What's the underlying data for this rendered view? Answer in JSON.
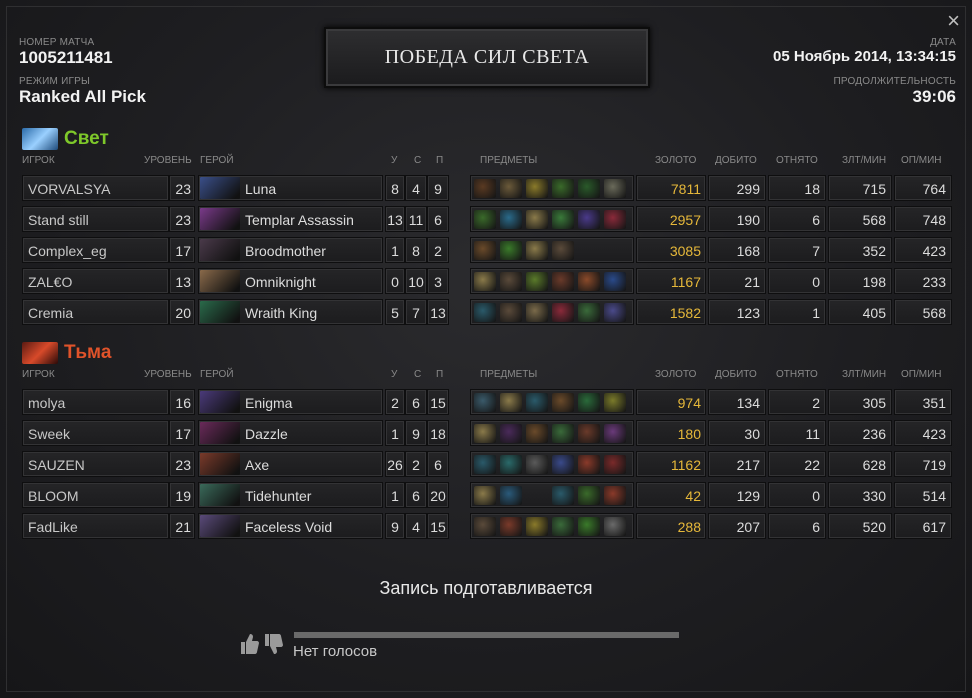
{
  "match": {
    "id_label": "НОМЕР МАТЧА",
    "id": "1005211481",
    "mode_label": "РЕЖИМ ИГРЫ",
    "mode": "Ranked All Pick",
    "date_label": "ДАТА",
    "date": "05 Ноябрь 2014, 13:34:15",
    "duration_label": "ПРОДОЛЖИТЕЛЬНОСТЬ",
    "duration": "39:06",
    "result": "ПОБЕДА СИЛ СВЕТА",
    "close_icon": "×"
  },
  "columns": {
    "player": "ИГРОК",
    "level": "УРОВЕНЬ",
    "hero": "ГЕРОЙ",
    "kills": "У",
    "deaths": "С",
    "assists": "П",
    "items": "ПРЕДМЕТЫ",
    "gold": "ЗОЛОТО",
    "last_hits": "ДОБИТО",
    "denies": "ОТНЯТО",
    "gpm": "ЗЛТ/МИН",
    "xpm": "ОП/МИН"
  },
  "colors": {
    "radiant": "#7ec82a",
    "dire": "#e0532a",
    "gold": "#e6b83a"
  },
  "radiant": {
    "name": "Свет",
    "players": [
      {
        "player": "VORVALSYA",
        "level": "23",
        "hero": "Luna",
        "k": "8",
        "d": "4",
        "a": "9",
        "gold": "7811",
        "lh": "299",
        "dn": "18",
        "gpm": "715",
        "xpm": "764",
        "portrait": "#3a4f8a",
        "items": [
          "#5a3a22",
          "#6b5a3a",
          "#8a7a2a",
          "#3a6a2a",
          "#2a5a2a",
          "#6a6a5a"
        ]
      },
      {
        "player": "Stand still",
        "level": "23",
        "hero": "Templar Assassin",
        "k": "13",
        "d": "11",
        "a": "6",
        "gold": "2957",
        "lh": "190",
        "dn": "6",
        "gpm": "568",
        "xpm": "748",
        "portrait": "#7a3a8a",
        "items": [
          "#3a6a2a",
          "#2a6a8a",
          "#8a7a4a",
          "#3a7a3a",
          "#4a3a8a",
          "#8a2a3a"
        ]
      },
      {
        "player": "Complex_eg",
        "level": "17",
        "hero": "Broodmother",
        "k": "1",
        "d": "8",
        "a": "2",
        "gold": "3085",
        "lh": "168",
        "dn": "7",
        "gpm": "352",
        "xpm": "423",
        "portrait": "#4a3a4a",
        "items": [
          "#6a4a2a",
          "#3a7a2a",
          "#8a7a4a",
          "#5a4a3a"
        ]
      },
      {
        "player": "ZAL€O",
        "level": "13",
        "hero": "Omniknight",
        "k": "0",
        "d": "10",
        "a": "3",
        "gold": "1167",
        "lh": "21",
        "dn": "0",
        "gpm": "198",
        "xpm": "233",
        "portrait": "#8a6a4a",
        "items": [
          "#8a7a4a",
          "#5a4a3a",
          "#5a7a2a",
          "#6a3a2a",
          "#8a4a2a",
          "#2a4a8a"
        ]
      },
      {
        "player": "Cremia",
        "level": "20",
        "hero": "Wraith King",
        "k": "5",
        "d": "7",
        "a": "13",
        "gold": "1582",
        "lh": "123",
        "dn": "1",
        "gpm": "405",
        "xpm": "568",
        "portrait": "#2a6a4a",
        "items": [
          "#2a5a6a",
          "#5a4a3a",
          "#7a6a4a",
          "#8a2a3a",
          "#3a6a3a",
          "#4a4a8a"
        ]
      }
    ]
  },
  "dire": {
    "name": "Тьма",
    "players": [
      {
        "player": "molya",
        "level": "16",
        "hero": "Enigma",
        "k": "2",
        "d": "6",
        "a": "15",
        "gold": "974",
        "lh": "134",
        "dn": "2",
        "gpm": "305",
        "xpm": "351",
        "portrait": "#4a3a7a",
        "items": [
          "#3a5a6a",
          "#8a7a4a",
          "#2a5a6a",
          "#6a4a2a",
          "#2a6a3a",
          "#7a7a2a"
        ]
      },
      {
        "player": "Sweek",
        "level": "17",
        "hero": "Dazzle",
        "k": "1",
        "d": "9",
        "a": "18",
        "gold": "180",
        "lh": "30",
        "dn": "11",
        "gpm": "236",
        "xpm": "423",
        "portrait": "#6a2a5a",
        "items": [
          "#8a7a4a",
          "#4a2a5a",
          "#6a4a2a",
          "#3a6a3a",
          "#6a3a2a",
          "#6a3a7a"
        ]
      },
      {
        "player": "SAUZEN",
        "level": "23",
        "hero": "Axe",
        "k": "26",
        "d": "2",
        "a": "6",
        "gold": "1162",
        "lh": "217",
        "dn": "22",
        "gpm": "628",
        "xpm": "719",
        "portrait": "#7a3a2a",
        "items": [
          "#2a5a6a",
          "#2a6a6a",
          "#5a5a5a",
          "#3a4a8a",
          "#8a3a2a",
          "#7a2a2a"
        ]
      },
      {
        "player": "BLOOM",
        "level": "19",
        "hero": "Tidehunter",
        "k": "1",
        "d": "6",
        "a": "20",
        "gold": "42",
        "lh": "129",
        "dn": "0",
        "gpm": "330",
        "xpm": "514",
        "portrait": "#3a6a5a",
        "items": [
          "#8a7a4a",
          "#2a5a7a",
          "",
          "#2a5a6a",
          "#3a6a2a",
          "#8a3a2a"
        ]
      },
      {
        "player": "FadLike",
        "level": "21",
        "hero": "Faceless Void",
        "k": "9",
        "d": "4",
        "a": "15",
        "gold": "288",
        "lh": "207",
        "dn": "6",
        "gpm": "520",
        "xpm": "617",
        "portrait": "#5a4a7a",
        "items": [
          "#5a4a3a",
          "#7a3a2a",
          "#8a7a2a",
          "#3a6a3a",
          "#3a7a2a",
          "#6a6a6a"
        ]
      }
    ]
  },
  "replay": {
    "status": "Запись подготавливается",
    "votes": "Нет голосов"
  }
}
